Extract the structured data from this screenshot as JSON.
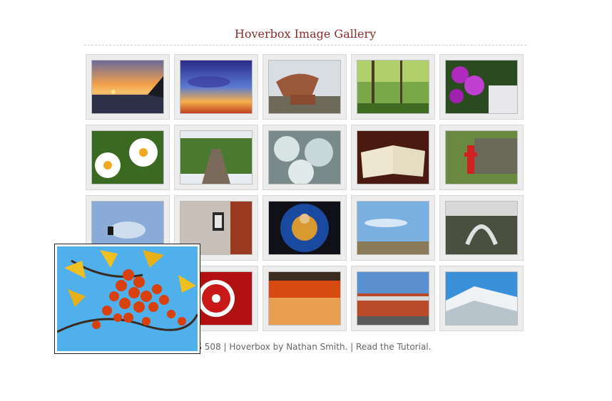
{
  "page": {
    "title": "Hoverbox Image Gallery",
    "footer": "| CSS 508 | Hoverbox by Nathan Smith. | Read the Tutorial."
  },
  "gallery": {
    "images": [
      {
        "name": "sunset-sea"
      },
      {
        "name": "sunset-birds"
      },
      {
        "name": "rock-formation"
      },
      {
        "name": "forest-path"
      },
      {
        "name": "purple-flowers"
      },
      {
        "name": "daisies"
      },
      {
        "name": "rail-tracks"
      },
      {
        "name": "frost-pine"
      },
      {
        "name": "open-bible"
      },
      {
        "name": "fire-hydrant"
      },
      {
        "name": "lamp-sky"
      },
      {
        "name": "wall-lantern"
      },
      {
        "name": "stained-glass"
      },
      {
        "name": "plains-sky"
      },
      {
        "name": "modern-sculpture"
      },
      {
        "name": "berries"
      },
      {
        "name": "umbrella-pattern"
      },
      {
        "name": "basketball-game"
      },
      {
        "name": "stadium"
      },
      {
        "name": "snowy-mountain"
      }
    ],
    "popup_image": {
      "name": "berries-enlarged"
    }
  },
  "colors": {
    "title": "#8b2a2a",
    "footer": "#666666",
    "frame_bg": "#ededed"
  }
}
